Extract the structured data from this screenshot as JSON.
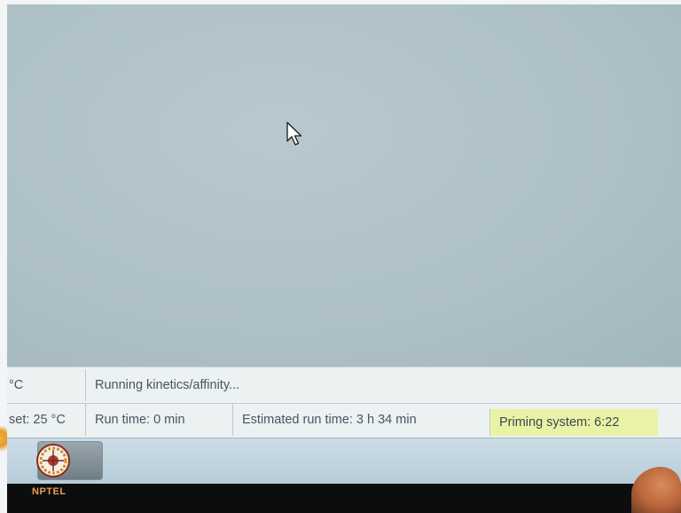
{
  "status_bar": {
    "row1": {
      "temperature_unit_fragment": "°C",
      "run_status": "Running kinetics/affinity..."
    },
    "row2": {
      "temperature_setpoint_fragment": "set: 25 °C",
      "run_time": "Run time: 0 min",
      "estimated_run_time": "Estimated run time: 3 h 34 min",
      "priming_status": "Priming system: 6:22"
    }
  },
  "taskbar": {
    "app_label": "NPTEL",
    "app_icon": "nptel-app-icon"
  },
  "colors": {
    "workspace": "#adc0c6",
    "status_bar": "#ecf1f2",
    "priming_highlight": "#eaf2a6",
    "taskbar": "#c3d6e0"
  }
}
